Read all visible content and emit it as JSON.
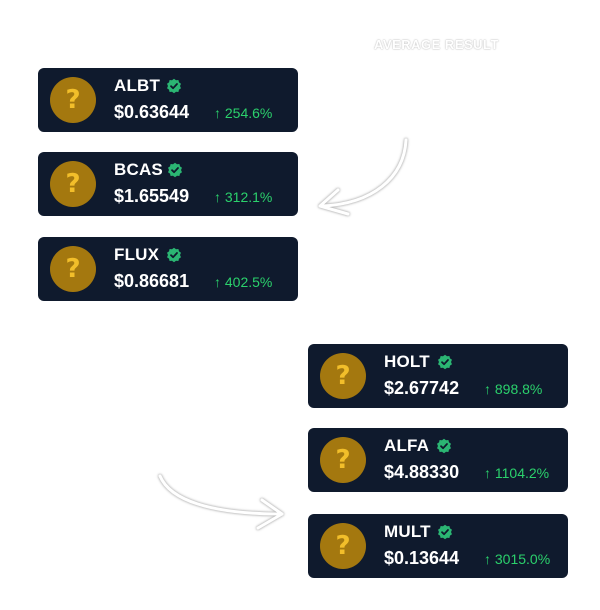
{
  "caption": "AVERAGE RESULT",
  "colors": {
    "card_background": "#0f1a2d",
    "coin_fill": "#a4780f",
    "coin_glyph": "#f2be2a",
    "verified_badge": "#2bb673",
    "positive_change": "#2bd16c"
  },
  "icons": {
    "coin": "question-mark-coin-icon",
    "verified": "verified-badge-icon",
    "change": "arrow-up-icon",
    "connector": "curved-arrow-icon"
  },
  "coin_glyph": "?",
  "change_arrow": "↑",
  "tokens": [
    {
      "symbol": "ALBT",
      "price": "$0.63644",
      "change": "254.6%"
    },
    {
      "symbol": "BCAS",
      "price": "$1.65549",
      "change": "312.1%"
    },
    {
      "symbol": "FLUX",
      "price": "$0.86681",
      "change": "402.5%"
    },
    {
      "symbol": "HOLT",
      "price": "$2.67742",
      "change": "898.8%"
    },
    {
      "symbol": "ALFA",
      "price": "$4.88330",
      "change": "1104.2%"
    },
    {
      "symbol": "MULT",
      "price": "$0.13644",
      "change": "3015.0%"
    }
  ]
}
